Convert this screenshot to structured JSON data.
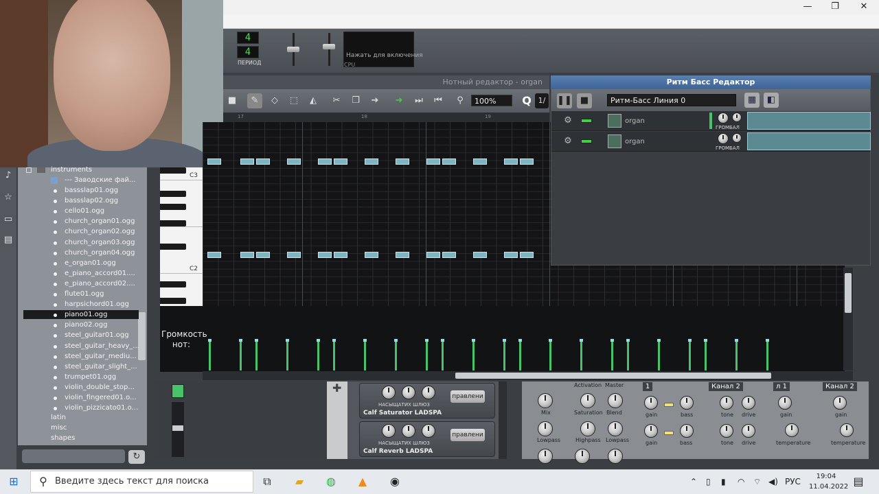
{
  "window": {
    "min": "—",
    "max": "❐",
    "close": "✕"
  },
  "toolbar": {
    "lcd_top": "4",
    "lcd_bottom": "4",
    "period_label": "ПЕРИОД",
    "cpu_hint": "Нажать для включения",
    "cpu_label": "CPU"
  },
  "piano_roll": {
    "title": "Нотный редактор - organ",
    "zoom": "100%",
    "quantize_icon": "Q",
    "quantize_value": "1/",
    "ruler": [
      "17",
      "18",
      "19"
    ],
    "key_labels": [
      "C3",
      "C2"
    ],
    "velocity_label": "Громкость нот:"
  },
  "rhythm_bass": {
    "title": "Ритм Басс Редактор",
    "line_select": "Ритм-Басс Линия 0",
    "tracks": [
      {
        "name": "organ",
        "knob_label": "ГРОМБАЛ"
      },
      {
        "name": "organ",
        "knob_label": "ГРОМБАЛ"
      }
    ]
  },
  "browser": {
    "folder": "instruments",
    "factory_link": "--- Заводские фай...",
    "files": [
      "bassslap01.ogg",
      "bassslap02.ogg",
      "cello01.ogg",
      "church_organ01.ogg",
      "church_organ02.ogg",
      "church_organ03.ogg",
      "church_organ04.ogg",
      "e_organ01.ogg",
      "e_piano_accord01....",
      "e_piano_accord02....",
      "flute01.ogg",
      "harpsichord01.ogg",
      "piano01.ogg",
      "piano02.ogg",
      "steel_guitar01.ogg",
      "steel_guitar_heavy_...",
      "steel_guitar_mediu...",
      "steel_guitar_slight_...",
      "trumpet01.ogg",
      "violin_double_stop...",
      "violin_fingered01.o...",
      "violin_pizzicato01.o..."
    ],
    "selected": "piano01.ogg",
    "folders": [
      "latin",
      "misc",
      "shapes"
    ]
  },
  "effects": [
    {
      "name": "Calf Saturator LADSPA",
      "sub": "НАСЫЩАТИХ ШЛЮЗ",
      "button": "правлени"
    },
    {
      "name": "Calf Reverb LADSPA",
      "sub": "НАСЫЩАТИХ ШЛЮЗ",
      "button": "правлени"
    }
  ],
  "eq": {
    "labels": [
      "Activation",
      "Master",
      "Mix",
      "Saturation",
      "Blend",
      "Lowpass",
      "Highpass",
      "Lowpass"
    ],
    "channels": [
      "1",
      "Канал 2",
      "л 1",
      "Канал 2"
    ],
    "knob_labels": [
      "gain",
      "bass",
      "tone",
      "drive",
      "gain",
      "bass",
      "tone",
      "drive",
      "gain",
      "temperature",
      "gain",
      "temperature"
    ]
  },
  "taskbar": {
    "search_placeholder": "Введите здесь текст для поиска",
    "lang": "РУС",
    "time": "19:04",
    "date": "11.04.2022"
  },
  "colors": {
    "note": "#7fb5c0",
    "velocity": "#47c46a",
    "rb_title": "#4a72a8"
  }
}
